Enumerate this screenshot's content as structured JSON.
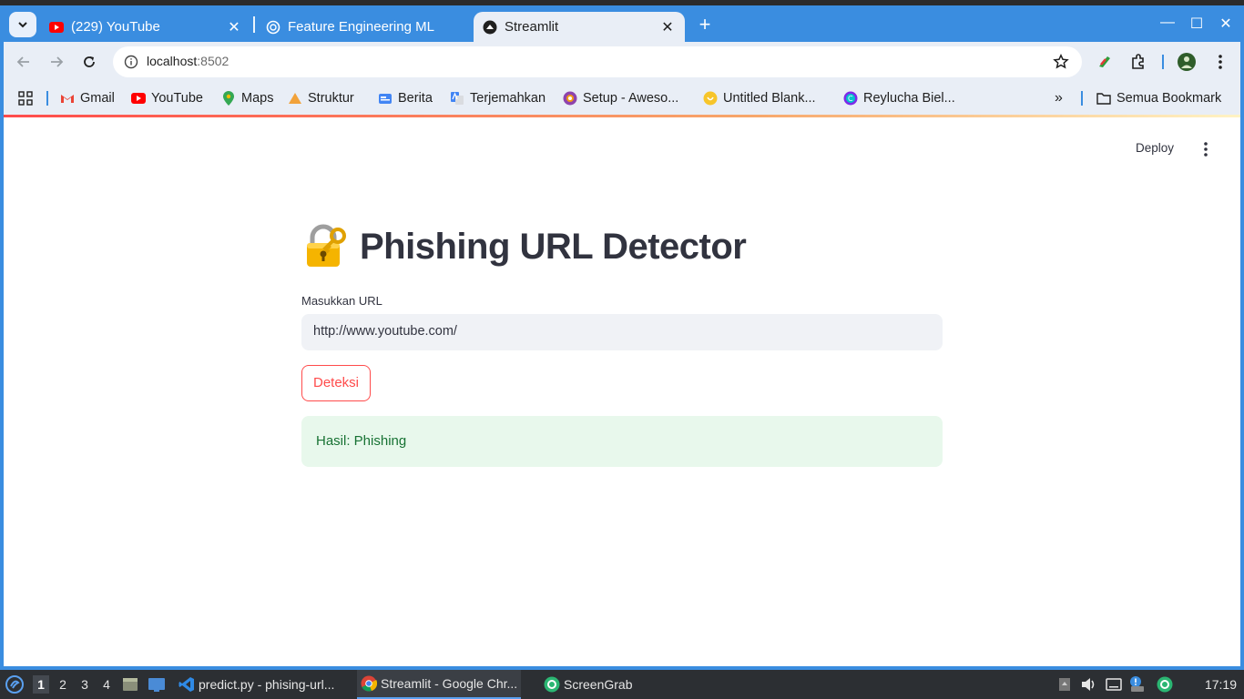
{
  "browser": {
    "tabs": [
      {
        "title": "(229) YouTube",
        "favicon": "youtube-icon"
      },
      {
        "title": "Feature Engineering ML",
        "favicon": "openai-icon"
      },
      {
        "title": "Streamlit",
        "favicon": "streamlit-icon",
        "active": true
      }
    ],
    "url_host": "localhost",
    "url_port": ":8502",
    "bookmarks": [
      {
        "label": "Gmail",
        "icon": "gmail-icon"
      },
      {
        "label": "YouTube",
        "icon": "youtube-icon"
      },
      {
        "label": "Maps",
        "icon": "maps-icon"
      },
      {
        "label": "Struktur",
        "icon": "pma-icon"
      },
      {
        "label": "Berita",
        "icon": "news-icon"
      },
      {
        "label": "Terjemahkan",
        "icon": "translate-icon"
      },
      {
        "label": "Setup - Aweso...",
        "icon": "setup-icon"
      },
      {
        "label": "Untitled Blank...",
        "icon": "blank-icon"
      },
      {
        "label": "Reylucha Biel...",
        "icon": "canva-icon"
      }
    ],
    "all_bookmarks": "Semua Bookmark"
  },
  "app": {
    "deploy_label": "Deploy",
    "title": "Phishing URL Detector",
    "input_label": "Masukkan URL",
    "input_value": "http://www.youtube.com/",
    "button_label": "Deteksi",
    "result_text": "Hasil: Phishing",
    "accent_color": "#ff4b4b",
    "success_bg": "#e8f8ec"
  },
  "taskbar": {
    "workspaces": [
      "1",
      "2",
      "3",
      "4"
    ],
    "apps": [
      {
        "label": "predict.py - phising-url...",
        "icon": "vscode-icon"
      },
      {
        "label": "Streamlit - Google Chr...",
        "icon": "chrome-icon",
        "active": true
      },
      {
        "label": "ScreenGrab",
        "icon": "screengrab-icon"
      }
    ],
    "clock": "17:19"
  }
}
